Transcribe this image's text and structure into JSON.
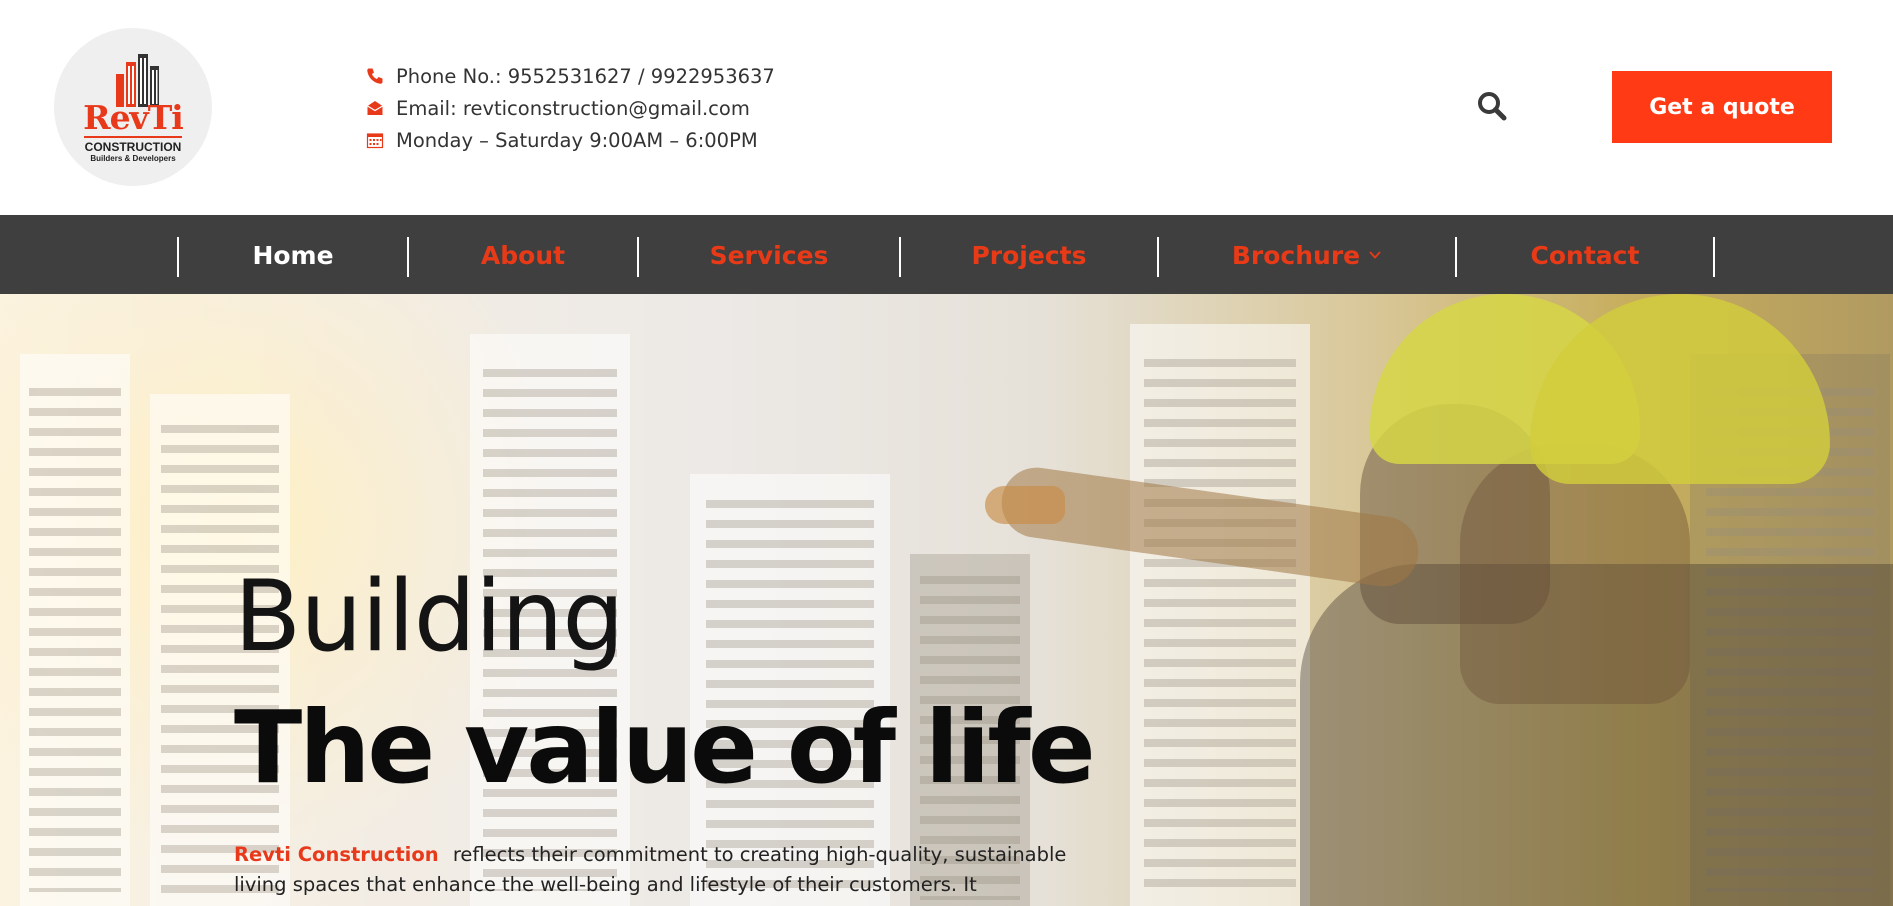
{
  "header": {
    "logo": {
      "brand": "RevTi",
      "sub1": "CONSTRUCTION",
      "sub2": "Builders & Developers"
    },
    "contacts": {
      "phone": "Phone No.: 9552531627 / 9922953637",
      "email": "Email: revticonstruction@gmail.com",
      "hours": "Monday – Saturday 9:00AM – 6:00PM"
    },
    "search_icon": "search-icon",
    "quote_label": "Get a quote"
  },
  "nav": {
    "items": [
      {
        "label": "Home",
        "active": true
      },
      {
        "label": "About"
      },
      {
        "label": "Services"
      },
      {
        "label": "Projects"
      },
      {
        "label": "Brochure",
        "has_dropdown": true
      },
      {
        "label": "Contact"
      }
    ]
  },
  "hero": {
    "title_line1": "Building",
    "title_line2": "The value of life",
    "desc_brand": "Revti Construction",
    "desc_text": "reflects their commitment to creating high-quality, sustainable living spaces that enhance the well-being and lifestyle of their customers. It"
  },
  "colors": {
    "accent": "#ff3a14",
    "nav_bg": "#3f3f3f",
    "nav_active": "#ffffff",
    "nav_text": "#e93a18"
  }
}
